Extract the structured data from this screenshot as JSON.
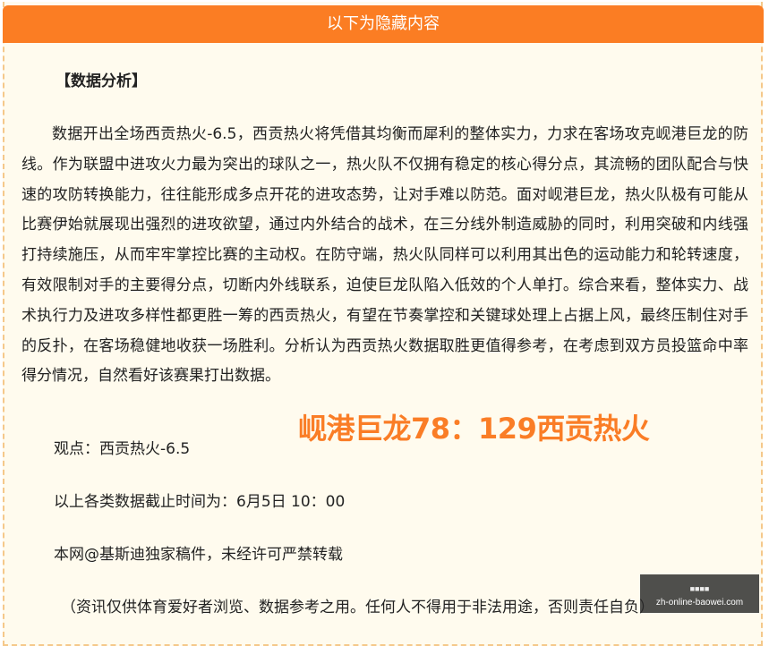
{
  "header": {
    "title": "以下为隐藏内容"
  },
  "section_title": "【数据分析】",
  "analysis_text": "数据开出全场西贡热火-6.5，西贡热火将凭借其均衡而犀利的整体实力，力求在客场攻克岘港巨龙的防线。作为联盟中进攻火力最为突出的球队之一，热火队不仅拥有稳定的核心得分点，其流畅的团队配合与快速的攻防转换能力，往往能形成多点开花的进攻态势，让对手难以防范。面对岘港巨龙，热火队极有可能从比赛伊始就展现出强烈的进攻欲望，通过内外结合的战术，在三分线外制造威胁的同时，利用突破和内线强打持续施压，从而牢牢掌控比赛的主动权。在防守端，热火队同样可以利用其出色的运动能力和轮转速度，有效限制对手的主要得分点，切断内外线联系，迫使巨龙队陷入低效的个人单打。综合来看，整体实力、战术执行力及进攻多样性都更胜一筹的西贡热火，有望在节奏掌控和关键球处理上占据上风，最终压制住对手的反扑，在客场稳健地收获一场胜利。分析认为西贡热火数据取胜更值得参考，在考虑到双方员投篮命中率得分情况，自然看好该赛果打出数据。",
  "score_overlay": "岘港巨龙78：129西贡热火",
  "viewpoint": "观点：西贡热火-6.5",
  "cutoff_time": "以上各类数据截止时间为：6月5日 10：00",
  "copyright": "本网@基斯迪独家稿件，未经许可严禁转载",
  "disclaimer": "（资讯仅供体育爱好者浏览、数据参考之用。任何人不得用于非法用途，否则责任自负）",
  "watermark": {
    "top_text": "■■■■",
    "bottom_text": "zh-online-baowei.com"
  },
  "colors": {
    "accent": "#fb7d23",
    "panel_bg": "#fffbee",
    "border": "#f5c88a"
  }
}
